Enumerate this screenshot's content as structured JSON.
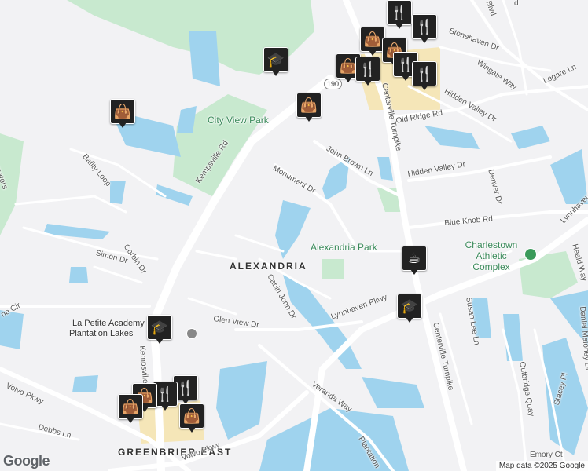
{
  "map": {
    "colors": {
      "land": "#f2f2f4",
      "water": "#9fd3ee",
      "park": "#c8e9cf",
      "road": "#ffffff",
      "shopping": "#f5e6b8",
      "pin": "#222222"
    },
    "area_labels": [
      "ALEXANDRIA",
      "GREENBRIER EAST"
    ],
    "park_labels": [
      "City View Park",
      "Alexandria Park",
      "Charlestown Athletic Complex"
    ],
    "poi_labels": [
      "La Petite Academy",
      "Plantation Lakes"
    ],
    "road_labels": {
      "kempsville": "Kempsville Rd",
      "kempsville2": "Kempsville Rd",
      "centerville": "Centerville Turnpike",
      "centerville2": "Centerville Turnpike",
      "monument": "Monument Dr",
      "john_brown": "John Brown Ln",
      "hidden_valley": "Hidden Valley Dr",
      "hidden_valley2": "Hidden Valley Dr",
      "old_ridge": "Old Ridge Rd",
      "stonehaven": "Stonehaven Dr",
      "wingate": "Wingate Way",
      "legare": "Legare Ln",
      "blue_knob": "Blue Knob Rd",
      "denver": "Denver Dr",
      "lynnhaven": "Lynnhaven Pkwy",
      "lynnhaven_r": "Lynnhaven",
      "heald": "Heald Way",
      "susan_lee": "Susan Lee Ln",
      "daniel_maloney": "Daniel Maloney Dr",
      "outbridge": "Outbridge Quay",
      "stacey": "Stacey Pl",
      "emory": "Emory Ct",
      "cabin_john": "Cabin John Dr",
      "glen_view": "Glen View Dr",
      "simon": "Simon Dr",
      "corbin": "Corbin Dr",
      "bafity": "Bafity Loop",
      "veranda": "Veranda Way",
      "plantation": "Plantation",
      "volvo": "Volvo Pkwy",
      "volvo2": "Volvo Pkwy",
      "debbs": "Debbs Ln",
      "ne_cir": "ne Cir",
      "blvd": "Blvd",
      "d_top": "d",
      "reaters": "reaters"
    },
    "route_shield": "190",
    "pins": [
      {
        "kind": "shopping-bag",
        "glyph": "👜"
      },
      {
        "kind": "school",
        "glyph": "🎓"
      },
      {
        "kind": "shopping-bag",
        "glyph": "👜"
      },
      {
        "kind": "shopping-bag",
        "glyph": "👜"
      },
      {
        "kind": "restaurant",
        "glyph": "🍴"
      },
      {
        "kind": "shopping-bag",
        "glyph": "👜"
      },
      {
        "kind": "restaurant",
        "glyph": "🍴"
      },
      {
        "kind": "shopping-bag",
        "glyph": "👜"
      },
      {
        "kind": "restaurant",
        "glyph": "🍴"
      },
      {
        "kind": "restaurant",
        "glyph": "🍴"
      },
      {
        "kind": "restaurant",
        "glyph": "🍴"
      },
      {
        "kind": "cafe",
        "glyph": "☕"
      },
      {
        "kind": "school",
        "glyph": "🎓"
      },
      {
        "kind": "school",
        "glyph": "🎓"
      },
      {
        "kind": "restaurant",
        "glyph": "🍴"
      },
      {
        "kind": "restaurant",
        "glyph": "🍴"
      },
      {
        "kind": "shopping-bag",
        "glyph": "👜"
      },
      {
        "kind": "shopping-bag",
        "glyph": "👜"
      },
      {
        "kind": "shopping-bag",
        "glyph": "👜"
      }
    ],
    "attribution": "Map data ©2025 Google",
    "logo": "Google"
  }
}
